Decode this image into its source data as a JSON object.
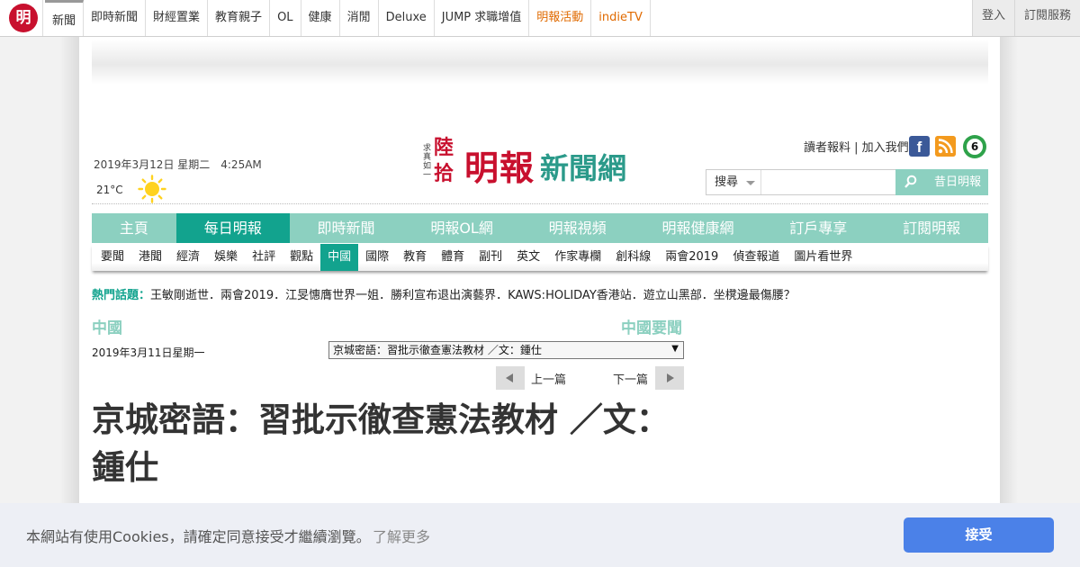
{
  "topnav": {
    "logo": "明",
    "items": [
      "新聞",
      "即時新聞",
      "財經置業",
      "教育親子",
      "OL",
      "健康",
      "消閒",
      "Deluxe",
      "JUMP 求職增值",
      "明報活動",
      "indieTV"
    ],
    "right": [
      "登入",
      "訂閱服務"
    ]
  },
  "header": {
    "date": "2019年3月12日 星期二　4:25AM",
    "temperature": "21°C",
    "weather_icon": "sun-icon",
    "brand": {
      "side_text": "求真如一",
      "anniversary": "陸拾",
      "name": "明報",
      "suffix": "新聞網"
    },
    "reader_links": "讀者報料 | 加入我們",
    "social_icons": [
      "facebook-icon",
      "rss-icon",
      "six-icon"
    ],
    "six_label": "6"
  },
  "search": {
    "select_value": "搜尋",
    "placeholder": "",
    "archive_label": "昔日明報"
  },
  "mainnav": {
    "items": [
      "主頁",
      "每日明報",
      "即時新聞",
      "明報OL網",
      "明報視頻",
      "明報健康網",
      "訂戶專享",
      "訂閱明報"
    ],
    "active": 1
  },
  "subnav": {
    "items": [
      "要聞",
      "港聞",
      "經濟",
      "娛樂",
      "社評",
      "觀點",
      "中國",
      "國際",
      "教育",
      "體育",
      "副刊",
      "英文",
      "作家專欄",
      "創科線",
      "兩會2019",
      "偵查報道",
      "圖片看世界"
    ],
    "active": 6
  },
  "hot_topics": {
    "label": "熱門話題：",
    "text": "王敏剛逝世．兩會2019．江旻憓膺世界一姐．勝利宣布退出演藝界．KAWS:HOLIDAY香港站．遊立山黑部．坐櫈邊最傷腰？"
  },
  "article": {
    "section": "中國",
    "section_right": "中國要聞",
    "date": "2019年3月11日星期一",
    "select_value": "京城密語：習批示徹查憲法教材 ／文：鍾仕",
    "prev_label": "上一篇",
    "next_label": "下一篇",
    "headline": "京城密語：習批示徹查憲法教材 ／文：鍾仕"
  },
  "cookie": {
    "message": "本網站有使用Cookies，請確定同意接受才繼續瀏覽。",
    "more_label": "了解更多",
    "accept_label": "接受"
  },
  "colors": {
    "teal": "#8cd0c0",
    "teal_dark": "#12a38e",
    "brand_red": "#c8102e",
    "orange": "#e06a00",
    "cookie_button": "#4b81e8"
  }
}
